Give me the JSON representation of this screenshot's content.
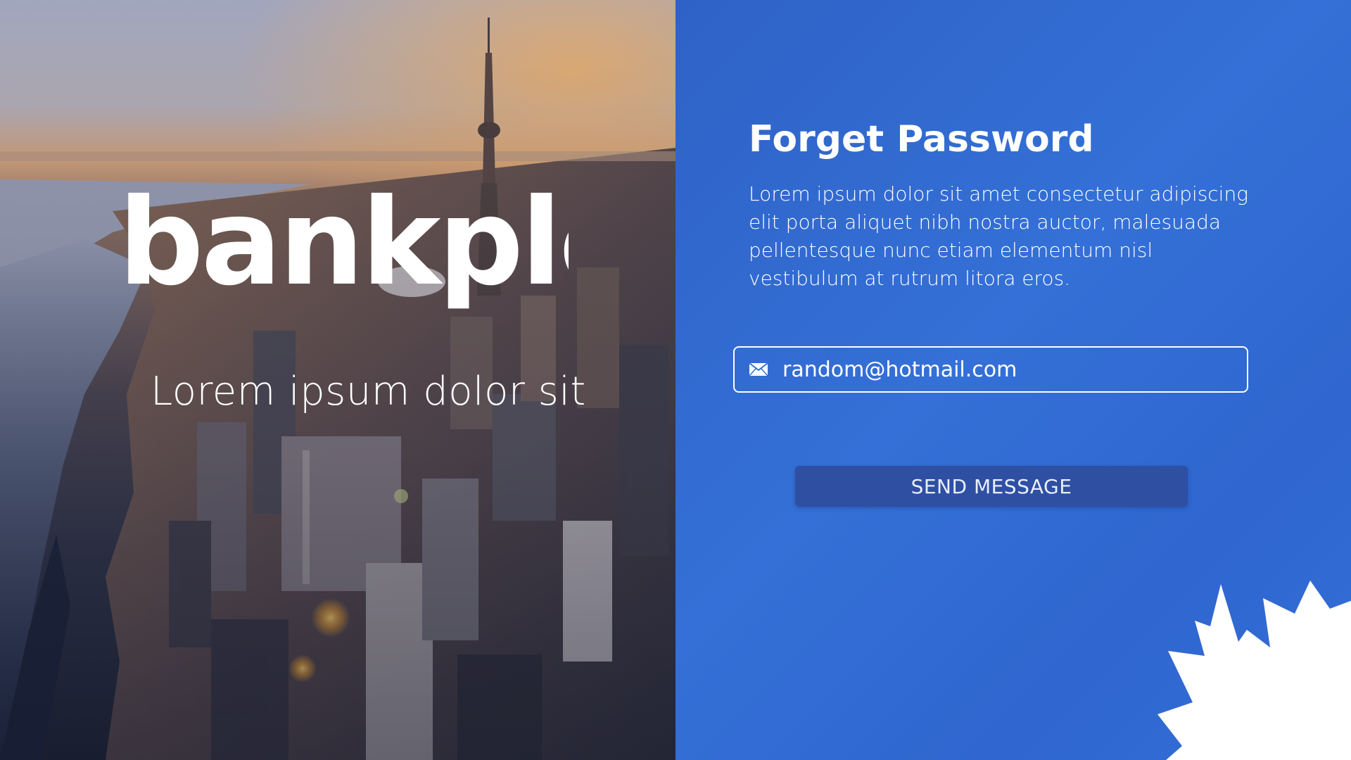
{
  "brand": {
    "logo_text": "bankple",
    "tagline": "Lorem ipsum dolor sit"
  },
  "form": {
    "title": "Forget Password",
    "description": "Lorem ipsum dolor sit amet consectetur adipiscing elit porta aliquet nibh nostra auctor, malesuada pellentesque nunc etiam elementum nisl vestibulum at rutrum litora eros.",
    "email": {
      "value": "random@hotmail.com",
      "icon": "mail-icon"
    },
    "submit_label": "SEND MESSAGE"
  },
  "decoration": {
    "leaf_icon": "maple-leaf-icon"
  },
  "colors": {
    "panel_blue": "#3470d7",
    "button_blue": "#2f4fa3",
    "text_white": "#ffffff"
  }
}
